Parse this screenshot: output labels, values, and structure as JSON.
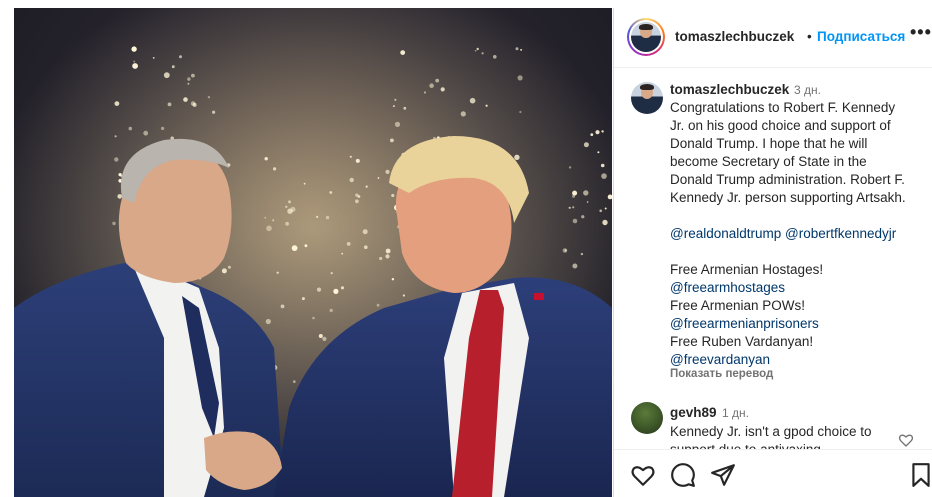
{
  "post": {
    "author": "tomaszlechbuczek",
    "separator": "•",
    "follow_label": "Подписаться",
    "more_label": "•••",
    "photo_icon": "photo-image"
  },
  "caption": {
    "author": "tomaszlechbuczek",
    "time": "3 дн.",
    "lines": [
      "Congratulations to Robert F. Kennedy",
      "Jr. on his good choice and support of",
      "Donald Trump. I hope that he will",
      "become Secretary of State in the",
      "Donald Trump administration. Robert F.",
      "Kennedy Jr. person supporting Artsakh."
    ],
    "mention_1": "@realdonaldtrump",
    "mention_2": "@robertfkennedyjr",
    "line_hostages": "Free Armenian Hostages!",
    "tag_hostages": "@freearmhostages",
    "line_pows": "Free Armenian POWs!",
    "tag_pows": "@freearmenianprisoners",
    "line_ruben": "Free Ruben Vardanyan!",
    "tag_ruben": "@freevardanyan",
    "translate_label": "Показать перевод"
  },
  "comment": {
    "author": "gevh89",
    "time": "1 дн.",
    "line_1": "Kennedy Jr. isn't a gpod choice to",
    "line_2": "support due to antivaxing"
  },
  "actions": {
    "icons": [
      "heart-icon",
      "comment-icon",
      "share-icon",
      "bookmark-icon"
    ]
  },
  "colors": {
    "follow": "#0095f6",
    "link": "#00376b",
    "muted": "#737373"
  }
}
